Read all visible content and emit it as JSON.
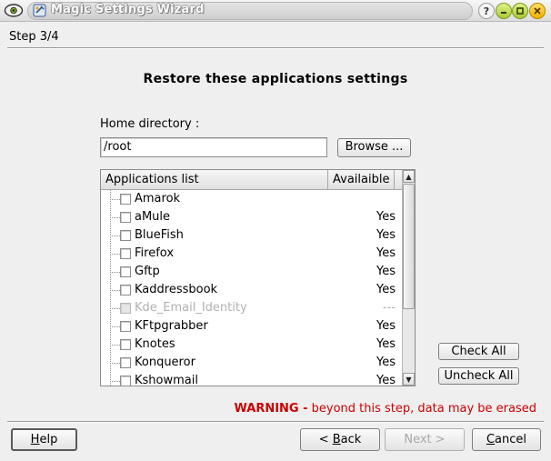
{
  "window": {
    "title": "Magic Settings Wizard",
    "help_button": "?"
  },
  "step": {
    "label": "Step 3/4"
  },
  "heading": "Restore these applications settings",
  "home": {
    "label": "Home directory :",
    "value": "/root",
    "browse_label": "Browse ..."
  },
  "list": {
    "columns": {
      "app": "Applications list",
      "avail": "Availaible"
    },
    "items": [
      {
        "name": "Amarok",
        "avail": "",
        "enabled": true
      },
      {
        "name": "aMule",
        "avail": "Yes",
        "enabled": true
      },
      {
        "name": "BlueFish",
        "avail": "Yes",
        "enabled": true
      },
      {
        "name": "Firefox",
        "avail": "Yes",
        "enabled": true
      },
      {
        "name": "Gftp",
        "avail": "Yes",
        "enabled": true
      },
      {
        "name": "Kaddressbook",
        "avail": "Yes",
        "enabled": true
      },
      {
        "name": "Kde_Email_Identity",
        "avail": "---",
        "enabled": false
      },
      {
        "name": "KFtpgrabber",
        "avail": "Yes",
        "enabled": true
      },
      {
        "name": "Knotes",
        "avail": "Yes",
        "enabled": true
      },
      {
        "name": "Konqueror",
        "avail": "Yes",
        "enabled": true
      },
      {
        "name": "Kshowmail",
        "avail": "Yes",
        "enabled": true
      }
    ]
  },
  "actions": {
    "check_all": "Check All",
    "uncheck_all": "Uncheck All"
  },
  "warning": {
    "strong": "WARNING -",
    "text": " beyond this step, data may be erased"
  },
  "buttons": {
    "help_underline": "H",
    "help_rest": "elp",
    "back_prefix": "< ",
    "back_underline": "B",
    "back_rest": "ack",
    "next": "Next >",
    "cancel_underline": "C",
    "cancel_rest": "ancel"
  },
  "colors": {
    "warning": "#cc0000",
    "disabled_text": "#b0b0b0"
  }
}
